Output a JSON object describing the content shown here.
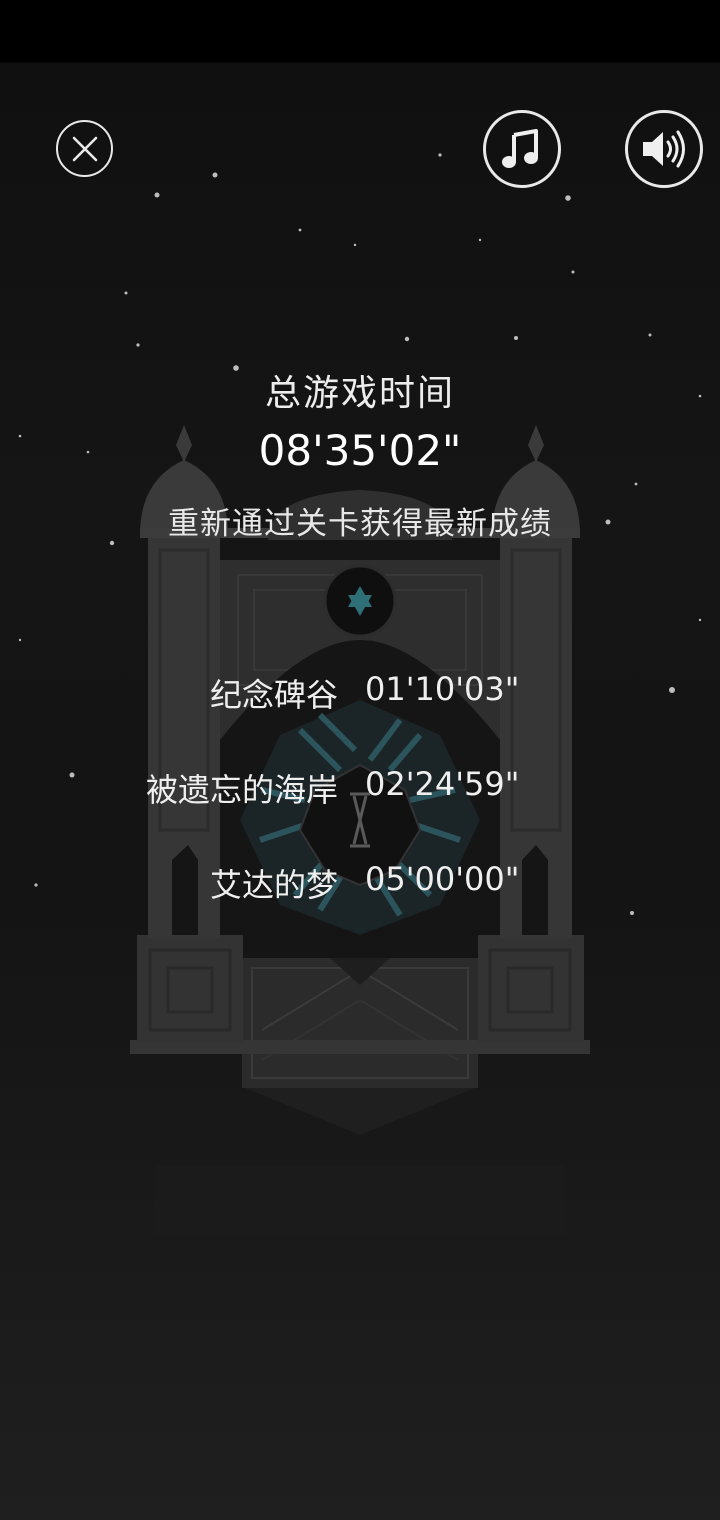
{
  "icons": {
    "close": "close-icon",
    "music": "music-note-icon",
    "sound": "speaker-icon",
    "level_emblem": "hexagram-icon"
  },
  "colors": {
    "background": "#151515",
    "text": "#f2f2f2",
    "temple_stone": "#3a3a3a",
    "emblem_accent": "#2f6f78"
  },
  "total": {
    "label": "总游戏时间",
    "time": "08'35'02\""
  },
  "hint": "重新通过关卡获得最新成绩",
  "records": [
    {
      "name": "纪念碑谷",
      "time": "01'10'03\""
    },
    {
      "name": "被遗忘的海岸",
      "time": "02'24'59\""
    },
    {
      "name": "艾达的梦",
      "time": "05'00'00\""
    }
  ]
}
